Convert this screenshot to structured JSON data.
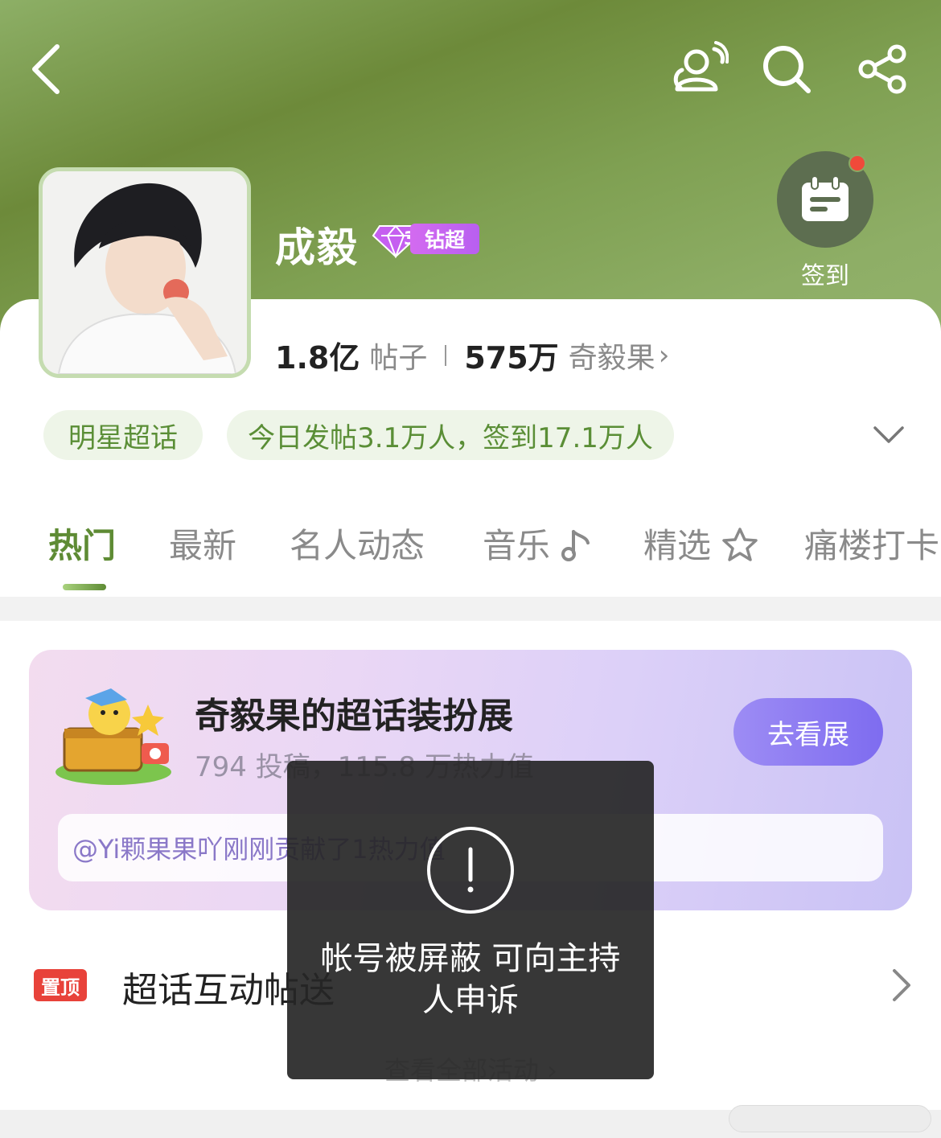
{
  "header": {
    "back_icon": "chevron-left-icon",
    "weibo_icon": "weibo-icon",
    "search_icon": "search-icon",
    "share_icon": "share-icon"
  },
  "profile": {
    "name": "成毅",
    "badge_level": "3",
    "badge_label": "钻超",
    "checkin_label": "签到",
    "posts_count": "1.8亿",
    "posts_label": "帖子",
    "fans_count": "575万",
    "fans_label": "奇毅果"
  },
  "pills": {
    "category": "明星超话",
    "today": "今日发帖3.1万人，签到17.1万人"
  },
  "tabs": [
    {
      "label": "热门"
    },
    {
      "label": "最新"
    },
    {
      "label": "名人动态"
    },
    {
      "label": "音乐"
    },
    {
      "label": "精选"
    },
    {
      "label": "痛楼打卡"
    }
  ],
  "banner": {
    "title": "奇毅果的超话装扮展",
    "subtitle": "794 投稿，115.8 万热力值",
    "button": "去看展",
    "ticker": "@Yi颗果果吖刚刚贡献了1热力值"
  },
  "pinned": {
    "tag": "置顶",
    "text": "超话互动帖送"
  },
  "view_all": "查看全部活动 ›",
  "toast": {
    "message": "帐号被屏蔽 可向主持人申诉"
  },
  "colors": {
    "accent_green": "#5e8b34",
    "pill_bg": "#eef5e8",
    "pin_red": "#e8423a",
    "badge_purple": "#c065f0"
  }
}
